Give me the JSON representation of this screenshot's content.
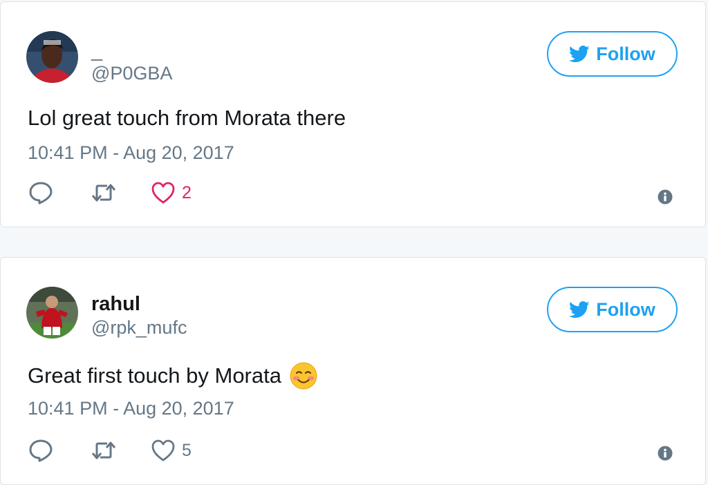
{
  "tweets": [
    {
      "display_name": "_",
      "handle": "@P0GBA",
      "text": "Lol great touch from Morata there",
      "emoji": "",
      "timestamp": "10:41 PM - Aug 20, 2017",
      "follow_label": "Follow",
      "like_count": "2",
      "liked": true,
      "avatar_icon": "avatar-photo-icon"
    },
    {
      "display_name": "rahul",
      "handle": "@rpk_mufc",
      "text": "Great first touch by Morata",
      "emoji": "☺️",
      "timestamp": "10:41 PM - Aug 20, 2017",
      "follow_label": "Follow",
      "like_count": "5",
      "liked": false,
      "avatar_icon": "avatar-photo-icon"
    }
  ],
  "colors": {
    "brand_blue": "#1da1f2",
    "like_red": "#e0245e",
    "text_primary": "#14171a",
    "text_secondary": "#657786",
    "card_border": "#dde3e8",
    "page_background": "#f5f8fa"
  },
  "icons": {
    "follow": "twitter-bird-icon",
    "reply": "reply-icon",
    "retweet": "retweet-icon",
    "like": "heart-icon",
    "info": "info-icon",
    "emoji": "smiling-face-emoji-icon"
  }
}
